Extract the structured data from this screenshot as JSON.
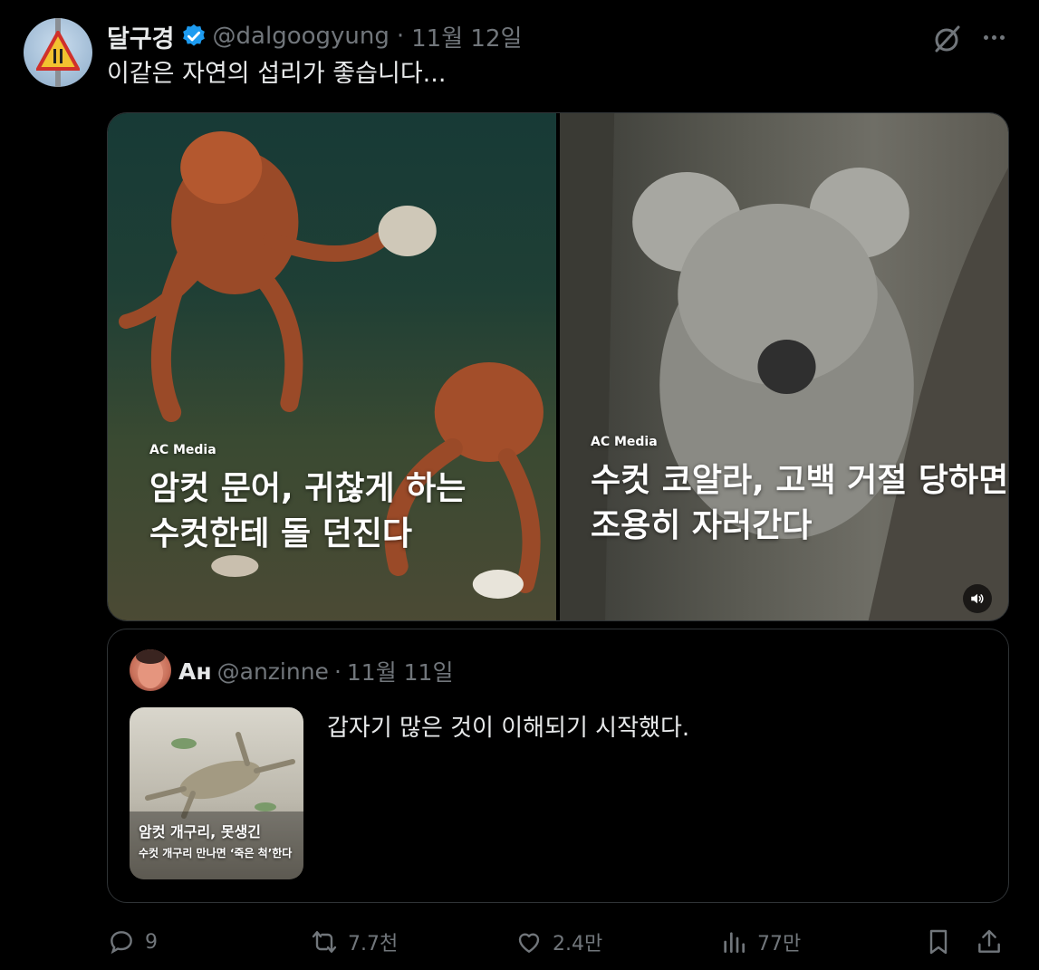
{
  "author": {
    "display_name": "달구경",
    "handle": "@dalgoogyung",
    "date": "11월 12일",
    "separator": "·"
  },
  "tweet": {
    "text": "이같은 자연의 섭리가 좋습니다..."
  },
  "media": [
    {
      "source": "AC Media",
      "lines": [
        "암컷 문어, 귀찮게 하는",
        "수컷한테 돌 던진다"
      ]
    },
    {
      "source": "AC Media",
      "lines": [
        "수컷 코알라, 고백 거절 당하면",
        "조용히 자러간다"
      ]
    }
  ],
  "quote": {
    "display_name": "Ан",
    "handle": "@anzinne",
    "date": "11월 11일",
    "separator": "·",
    "text": "갑자기 많은 것이 이해되기 시작했다.",
    "thumb_title": "암컷 개구리, 못생긴",
    "thumb_subtitle": "수컷 개구리 만나면 ‘죽은 척’한다"
  },
  "actions": {
    "replies": "9",
    "reposts": "7.7천",
    "likes": "2.4만",
    "views": "77만"
  },
  "colors": {
    "background": "#000000",
    "text": "#e7e9ea",
    "muted": "#71767b",
    "border": "#2f3336",
    "verified": "#1d9bf0"
  },
  "icons": [
    "grok-icon",
    "more-icon",
    "verified-icon",
    "volume-icon",
    "reply-icon",
    "retweet-icon",
    "like-icon",
    "views-icon",
    "bookmark-icon",
    "share-icon"
  ]
}
